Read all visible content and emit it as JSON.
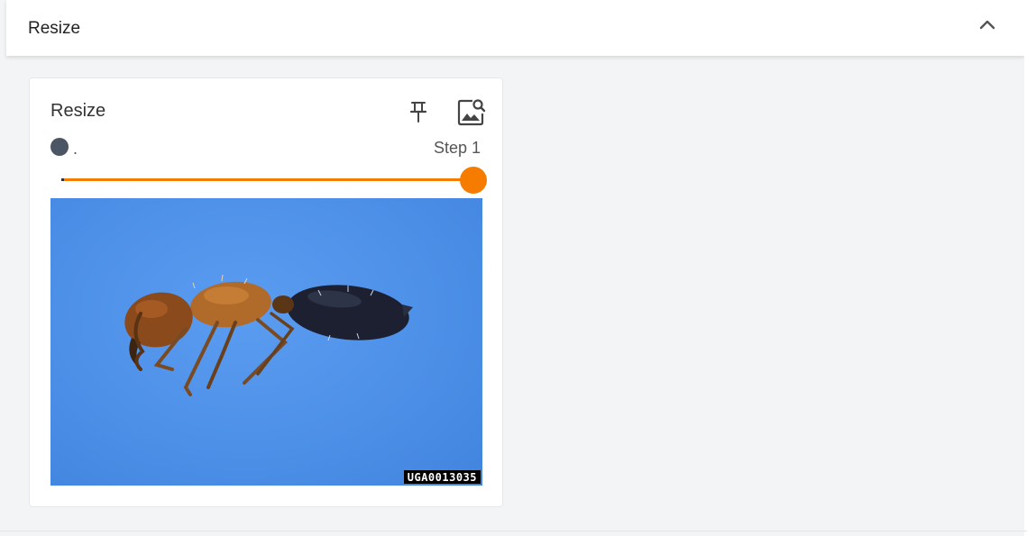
{
  "section": {
    "title": "Resize",
    "collapse_icon": "chevron-up-icon"
  },
  "card": {
    "title": "Resize",
    "pin_icon": "pin-icon",
    "image_search_icon": "image-search-icon",
    "status_text": ".",
    "status_color": "#4b5563",
    "step_label": "Step 1",
    "slider": {
      "value_fraction": 1.0,
      "color": "#f57c00"
    },
    "image": {
      "description_icon": "ant-photo",
      "caption": "UGA0013035",
      "background_color": "#4d90e8"
    }
  }
}
